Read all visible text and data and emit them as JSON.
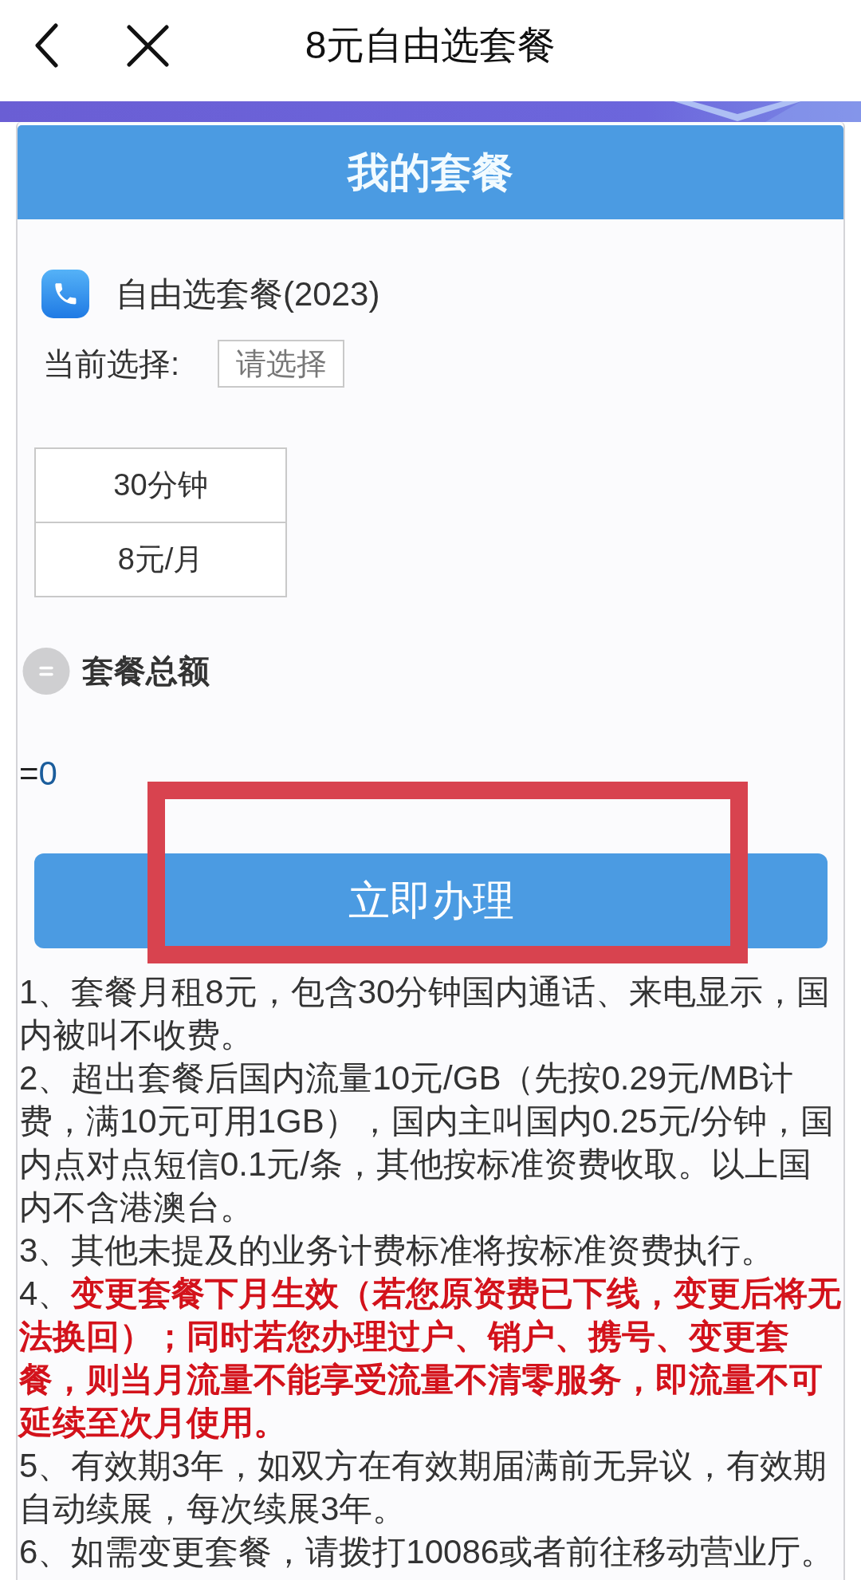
{
  "header": {
    "title": "8元自由选套餐"
  },
  "card": {
    "title": "我的套餐"
  },
  "plan": {
    "name": "自由选套餐(2023)"
  },
  "selection": {
    "label": "当前选择:",
    "placeholder": "请选择"
  },
  "options": [
    {
      "rows": [
        "30分钟",
        "8元/月"
      ],
      "selected": false
    }
  ],
  "total": {
    "label": "套餐总额",
    "prefix": "=",
    "amount": "0"
  },
  "action": {
    "label": "立即办理"
  },
  "annotation_frame": {
    "visible": true
  },
  "notes": [
    "1、套餐月租8元，包含30分钟国内通话、来电显示，国内被叫不收费。",
    "2、超出套餐后国内流量10元/GB（先按0.29元/MB计费，满10元可用1GB），国内主叫国内0.25元/分钟，国内点对点短信0.1元/条，其他按标准资费收取。以上国内不含港澳台。",
    "3、其他未提及的业务计费标准将按标准资费执行。",
    "4、**变更套餐下月生效（若您原资费已下线，变更后将无法换回）；同时若您办理过户、销户、携号、变更套餐，则当月流量不能享受流量不清零服务，即流量不可延续至次月使用。**",
    "5、有效期3年，如双方在有效期届满前无异议，有效期自动续展，每次续展3年。",
    "6、如需变更套餐，请拨打10086或者前往移动营业厅。"
  ]
}
